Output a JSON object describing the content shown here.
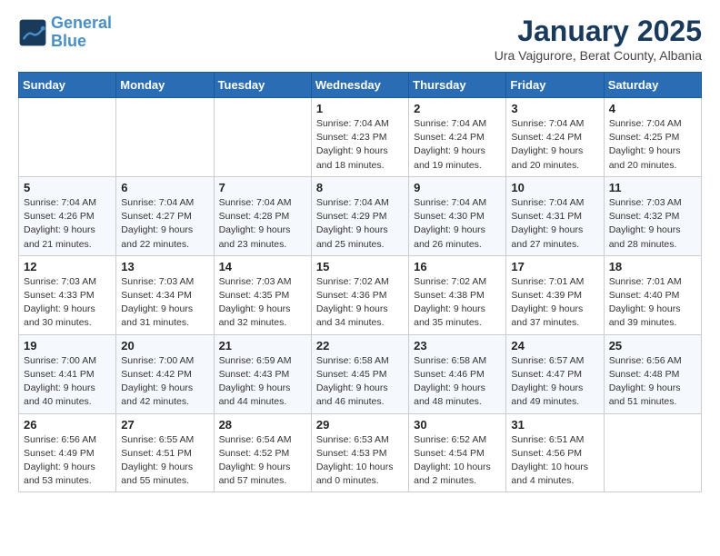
{
  "header": {
    "logo_line1": "General",
    "logo_line2": "Blue",
    "title": "January 2025",
    "subtitle": "Ura Vajgurore, Berat County, Albania"
  },
  "weekdays": [
    "Sunday",
    "Monday",
    "Tuesday",
    "Wednesday",
    "Thursday",
    "Friday",
    "Saturday"
  ],
  "weeks": [
    [
      {
        "day": "",
        "info": ""
      },
      {
        "day": "",
        "info": ""
      },
      {
        "day": "",
        "info": ""
      },
      {
        "day": "1",
        "info": "Sunrise: 7:04 AM\nSunset: 4:23 PM\nDaylight: 9 hours\nand 18 minutes."
      },
      {
        "day": "2",
        "info": "Sunrise: 7:04 AM\nSunset: 4:24 PM\nDaylight: 9 hours\nand 19 minutes."
      },
      {
        "day": "3",
        "info": "Sunrise: 7:04 AM\nSunset: 4:24 PM\nDaylight: 9 hours\nand 20 minutes."
      },
      {
        "day": "4",
        "info": "Sunrise: 7:04 AM\nSunset: 4:25 PM\nDaylight: 9 hours\nand 20 minutes."
      }
    ],
    [
      {
        "day": "5",
        "info": "Sunrise: 7:04 AM\nSunset: 4:26 PM\nDaylight: 9 hours\nand 21 minutes."
      },
      {
        "day": "6",
        "info": "Sunrise: 7:04 AM\nSunset: 4:27 PM\nDaylight: 9 hours\nand 22 minutes."
      },
      {
        "day": "7",
        "info": "Sunrise: 7:04 AM\nSunset: 4:28 PM\nDaylight: 9 hours\nand 23 minutes."
      },
      {
        "day": "8",
        "info": "Sunrise: 7:04 AM\nSunset: 4:29 PM\nDaylight: 9 hours\nand 25 minutes."
      },
      {
        "day": "9",
        "info": "Sunrise: 7:04 AM\nSunset: 4:30 PM\nDaylight: 9 hours\nand 26 minutes."
      },
      {
        "day": "10",
        "info": "Sunrise: 7:04 AM\nSunset: 4:31 PM\nDaylight: 9 hours\nand 27 minutes."
      },
      {
        "day": "11",
        "info": "Sunrise: 7:03 AM\nSunset: 4:32 PM\nDaylight: 9 hours\nand 28 minutes."
      }
    ],
    [
      {
        "day": "12",
        "info": "Sunrise: 7:03 AM\nSunset: 4:33 PM\nDaylight: 9 hours\nand 30 minutes."
      },
      {
        "day": "13",
        "info": "Sunrise: 7:03 AM\nSunset: 4:34 PM\nDaylight: 9 hours\nand 31 minutes."
      },
      {
        "day": "14",
        "info": "Sunrise: 7:03 AM\nSunset: 4:35 PM\nDaylight: 9 hours\nand 32 minutes."
      },
      {
        "day": "15",
        "info": "Sunrise: 7:02 AM\nSunset: 4:36 PM\nDaylight: 9 hours\nand 34 minutes."
      },
      {
        "day": "16",
        "info": "Sunrise: 7:02 AM\nSunset: 4:38 PM\nDaylight: 9 hours\nand 35 minutes."
      },
      {
        "day": "17",
        "info": "Sunrise: 7:01 AM\nSunset: 4:39 PM\nDaylight: 9 hours\nand 37 minutes."
      },
      {
        "day": "18",
        "info": "Sunrise: 7:01 AM\nSunset: 4:40 PM\nDaylight: 9 hours\nand 39 minutes."
      }
    ],
    [
      {
        "day": "19",
        "info": "Sunrise: 7:00 AM\nSunset: 4:41 PM\nDaylight: 9 hours\nand 40 minutes."
      },
      {
        "day": "20",
        "info": "Sunrise: 7:00 AM\nSunset: 4:42 PM\nDaylight: 9 hours\nand 42 minutes."
      },
      {
        "day": "21",
        "info": "Sunrise: 6:59 AM\nSunset: 4:43 PM\nDaylight: 9 hours\nand 44 minutes."
      },
      {
        "day": "22",
        "info": "Sunrise: 6:58 AM\nSunset: 4:45 PM\nDaylight: 9 hours\nand 46 minutes."
      },
      {
        "day": "23",
        "info": "Sunrise: 6:58 AM\nSunset: 4:46 PM\nDaylight: 9 hours\nand 48 minutes."
      },
      {
        "day": "24",
        "info": "Sunrise: 6:57 AM\nSunset: 4:47 PM\nDaylight: 9 hours\nand 49 minutes."
      },
      {
        "day": "25",
        "info": "Sunrise: 6:56 AM\nSunset: 4:48 PM\nDaylight: 9 hours\nand 51 minutes."
      }
    ],
    [
      {
        "day": "26",
        "info": "Sunrise: 6:56 AM\nSunset: 4:49 PM\nDaylight: 9 hours\nand 53 minutes."
      },
      {
        "day": "27",
        "info": "Sunrise: 6:55 AM\nSunset: 4:51 PM\nDaylight: 9 hours\nand 55 minutes."
      },
      {
        "day": "28",
        "info": "Sunrise: 6:54 AM\nSunset: 4:52 PM\nDaylight: 9 hours\nand 57 minutes."
      },
      {
        "day": "29",
        "info": "Sunrise: 6:53 AM\nSunset: 4:53 PM\nDaylight: 10 hours\nand 0 minutes."
      },
      {
        "day": "30",
        "info": "Sunrise: 6:52 AM\nSunset: 4:54 PM\nDaylight: 10 hours\nand 2 minutes."
      },
      {
        "day": "31",
        "info": "Sunrise: 6:51 AM\nSunset: 4:56 PM\nDaylight: 10 hours\nand 4 minutes."
      },
      {
        "day": "",
        "info": ""
      }
    ]
  ]
}
